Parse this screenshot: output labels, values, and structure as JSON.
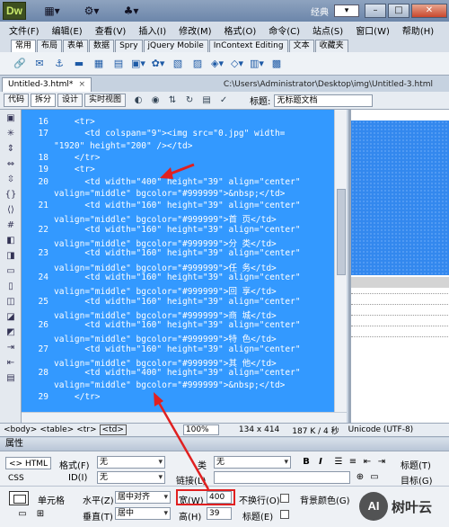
{
  "titlebar": {
    "logo": "Dw",
    "workspace": "经典",
    "search": "▾",
    "minimize": "–",
    "maximize": "□",
    "close": "✕"
  },
  "menu": [
    "文件(F)",
    "编辑(E)",
    "查看(V)",
    "插入(I)",
    "修改(M)",
    "格式(O)",
    "命令(C)",
    "站点(S)",
    "窗口(W)",
    "帮助(H)"
  ],
  "insert_tabs": [
    {
      "label": "常用",
      "active": true
    },
    {
      "label": "布局",
      "active": false
    },
    {
      "label": "表单",
      "active": false
    },
    {
      "label": "数据",
      "active": false
    },
    {
      "label": "Spry",
      "active": false
    },
    {
      "label": "jQuery Mobile",
      "active": false
    },
    {
      "label": "InContext Editing",
      "active": false
    },
    {
      "label": "文本",
      "active": false
    },
    {
      "label": "收藏夹",
      "active": false
    }
  ],
  "document": {
    "tab_name": "Untitled-3.html*",
    "path": "C:\\Users\\Administrator\\Desktop\\img\\Untitled-3.html",
    "close": "×"
  },
  "view_toolbar": {
    "code": "代码",
    "split": "拆分",
    "design": "设计",
    "live_view": "实时视图",
    "title_label": "标题:",
    "title_value": "无标题文档"
  },
  "code_lines": [
    {
      "num": "16",
      "text": "    <tr>"
    },
    {
      "num": "17",
      "text": "      <td colspan=\"9\"><img src=\"0.jpg\" width="
    },
    {
      "num": "",
      "text": "\"1920\" height=\"200\" /></td>"
    },
    {
      "num": "18",
      "text": "    </tr>"
    },
    {
      "num": "19",
      "text": "    <tr>"
    },
    {
      "num": "20",
      "text": "      <td width=\"400\" height=\"39\" align=\"center\""
    },
    {
      "num": "",
      "text": "valign=\"middle\" bgcolor=\"#999999\">&nbsp;</td>"
    },
    {
      "num": "21",
      "text": "      <td width=\"160\" height=\"39\" align=\"center\""
    },
    {
      "num": "",
      "text": "valign=\"middle\" bgcolor=\"#999999\">首 页</td>"
    },
    {
      "num": "22",
      "text": "      <td width=\"160\" height=\"39\" align=\"center\""
    },
    {
      "num": "",
      "text": "valign=\"middle\" bgcolor=\"#999999\">分 类</td>"
    },
    {
      "num": "23",
      "text": "      <td width=\"160\" height=\"39\" align=\"center\""
    },
    {
      "num": "",
      "text": "valign=\"middle\" bgcolor=\"#999999\">任 务</td>"
    },
    {
      "num": "24",
      "text": "      <td width=\"160\" height=\"39\" align=\"center\""
    },
    {
      "num": "",
      "text": "valign=\"middle\" bgcolor=\"#999999\">回 享</td>"
    },
    {
      "num": "25",
      "text": "      <td width=\"160\" height=\"39\" align=\"center\""
    },
    {
      "num": "",
      "text": "valign=\"middle\" bgcolor=\"#999999\">商 城</td>"
    },
    {
      "num": "26",
      "text": "      <td width=\"160\" height=\"39\" align=\"center\""
    },
    {
      "num": "",
      "text": "valign=\"middle\" bgcolor=\"#999999\">特 色</td>"
    },
    {
      "num": "27",
      "text": "      <td width=\"160\" height=\"39\" align=\"center\""
    },
    {
      "num": "",
      "text": "valign=\"middle\" bgcolor=\"#999999\">其 他</td>"
    },
    {
      "num": "28",
      "text": "      <td width=\"400\" height=\"39\" align=\"center\""
    },
    {
      "num": "",
      "text": "valign=\"middle\" bgcolor=\"#999999\">&nbsp;</td>"
    },
    {
      "num": "29",
      "text": "    </tr>"
    }
  ],
  "status": {
    "tags": [
      "<body>",
      "<table>",
      "<tr>"
    ],
    "selected_tag": "<td>",
    "zoom": "100%",
    "dimensions": "134 x 414",
    "size": "187 K / 4 秒",
    "encoding": "Unicode (UTF-8)"
  },
  "properties": {
    "header": "属性",
    "html_mode": "<> HTML",
    "css_mode": "CSS",
    "format_label": "格式(F)",
    "format_value": "无",
    "id_label": "ID(I)",
    "id_value": "无",
    "class_label": "类",
    "class_value": "无",
    "link_label": "链接(L)",
    "title_label": "标题(T)",
    "target_label": "目标(G)",
    "cell_label": "单元格",
    "halign_label": "水平(Z)",
    "halign_value": "居中对齐",
    "valign_label": "垂直(T)",
    "valign_value": "居中",
    "width_label": "宽(W)",
    "width_value": "400",
    "height_label": "高(H)",
    "height_value": "39",
    "nowrap_label": "不换行(O)",
    "header_label": "标题(E)",
    "bgcolor_label": "背景颜色(G)",
    "bold": "B",
    "italic": "I"
  },
  "watermark": {
    "logo": "AI",
    "text": "树叶云"
  }
}
